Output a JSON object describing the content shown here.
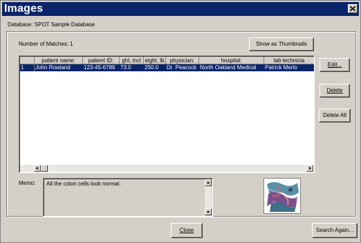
{
  "window": {
    "title": "Images",
    "close_label": "close"
  },
  "database": {
    "label": "Database:",
    "name": "SPOT Sample Database"
  },
  "matches": {
    "label": "Number of Matches:",
    "count": "1"
  },
  "buttons": {
    "show_thumbnails": "Show as Thumbnails",
    "edit": "Edit...",
    "delete": "Delete",
    "delete_all": "Delete All",
    "close": "Close",
    "search_again": "Search Again..."
  },
  "grid": {
    "columns": [
      "patient name:",
      "patient ID:",
      "ght, incl",
      "eight, lb",
      "physician:",
      "hospital:",
      "lab technicia"
    ],
    "rows": [
      {
        "index": "1",
        "cells": [
          "John Rowland",
          "123-45-6789",
          "73.0",
          "250.0",
          "Dr. Peacock",
          "North Oakland Medical",
          "Patrick Merlo"
        ]
      }
    ]
  },
  "memo": {
    "label": "Memo:",
    "text": "All the colon cells look normal."
  },
  "icons": {
    "close": "close-icon",
    "scroll_left": "arrow-left-icon",
    "scroll_right": "arrow-right-icon",
    "scroll_up": "arrow-up-icon",
    "scroll_down": "arrow-down-icon"
  },
  "colors": {
    "titlebar": "#0a246a",
    "window_bg": "#d4d0c8",
    "selection": "#0a246a"
  }
}
